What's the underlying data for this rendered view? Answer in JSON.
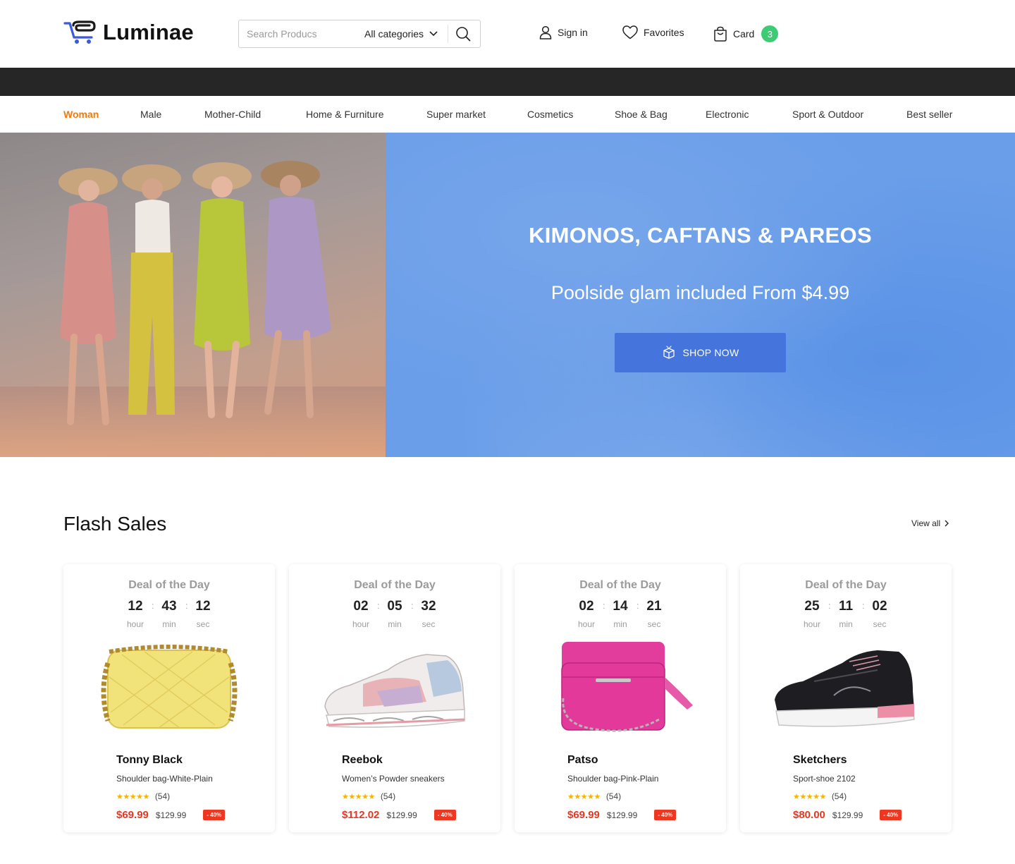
{
  "header": {
    "brand": "Luminae",
    "search": {
      "placeholder": "Search Producs",
      "category": "All categories"
    },
    "links": {
      "sign_in": "Sign in",
      "favorites": "Favorites",
      "cart": "Card",
      "cart_count": "3"
    }
  },
  "nav": {
    "items": [
      "Woman",
      "Male",
      "Mother-Child",
      "Home & Furniture",
      "Super market",
      "Cosmetics",
      "Shoe & Bag",
      "Electronic",
      "Sport & Outdoor",
      "Best seller"
    ],
    "active": "Woman"
  },
  "hero": {
    "title": "KIMONOS, CAFTANS & PAREOS",
    "subtitle": "Poolside glam included From $4.99",
    "button": "SHOP NOW"
  },
  "flash_sales": {
    "title": "Flash Sales",
    "view_all": "View all",
    "cards": [
      {
        "deal": "Deal of the Day",
        "hour": "12",
        "min": "43",
        "sec": "12",
        "hour_label": "hour",
        "min_label": "min",
        "sec_label": "sec",
        "name": "Tonny Black",
        "desc": "Shoulder bag-White-Plain",
        "rating_count": "(54)",
        "price": "$69.99",
        "old_price": "$129.99",
        "discount": "- 40%",
        "image": "yellow-bag"
      },
      {
        "deal": "Deal of the Day",
        "hour": "02",
        "min": "05",
        "sec": "32",
        "hour_label": "hour",
        "min_label": "min",
        "sec_label": "sec",
        "name": "Reebok",
        "desc": "Women’s Powder sneakers",
        "rating_count": "(54)",
        "price": "$112.02",
        "old_price": "$129.99",
        "discount": "- 40%",
        "image": "pastel-sneaker"
      },
      {
        "deal": "Deal of the Day",
        "hour": "02",
        "min": "14",
        "sec": "21",
        "hour_label": "hour",
        "min_label": "min",
        "sec_label": "sec",
        "name": "Patso",
        "desc": "Shoulder bag-Pink-Plain",
        "rating_count": "(54)",
        "price": "$69.99",
        "old_price": "$129.99",
        "discount": "- 40%",
        "image": "pink-bag"
      },
      {
        "deal": "Deal of the Day",
        "hour": "25",
        "min": "11",
        "sec": "02",
        "hour_label": "hour",
        "min_label": "min",
        "sec_label": "sec",
        "name": "Sketchers",
        "desc": "Sport-shoe 2102",
        "rating_count": "(54)",
        "price": "$80.00",
        "old_price": "$129.99",
        "discount": "- 40%",
        "image": "black-sneaker"
      }
    ]
  },
  "colors": {
    "accent": "#f2790e",
    "brand_blue": "#3b5bdb",
    "hero_blue": "#6a9ee9",
    "button_blue": "#4574dd",
    "sale_red": "#e8361f",
    "badge_green": "#3ecb75",
    "star": "#f5b301"
  }
}
